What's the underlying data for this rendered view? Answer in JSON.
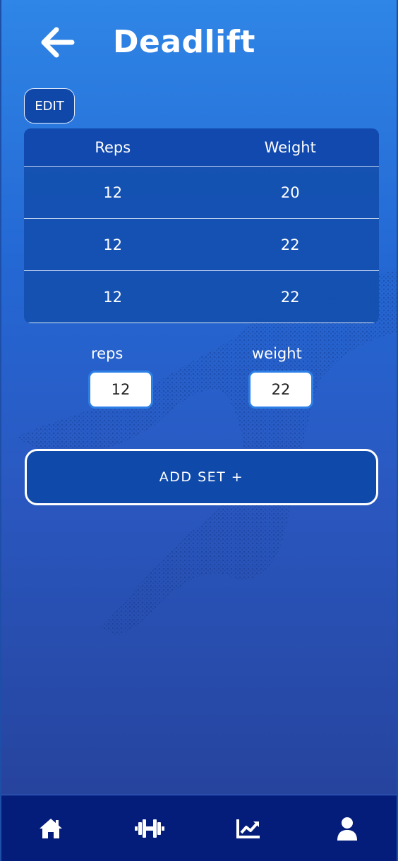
{
  "header": {
    "title": "Deadlift",
    "back_icon": "arrow-left-icon"
  },
  "edit_button": {
    "label": "EDIT"
  },
  "table": {
    "columns": [
      "Reps",
      "Weight"
    ],
    "rows": [
      {
        "reps": "12",
        "weight": "20"
      },
      {
        "reps": "12",
        "weight": "22"
      },
      {
        "reps": "12",
        "weight": "22"
      }
    ]
  },
  "inputs": {
    "reps": {
      "label": "reps",
      "value": "12"
    },
    "weight": {
      "label": "weight",
      "value": "22"
    }
  },
  "add_button": {
    "label": "ADD SET +"
  },
  "bottom_nav": [
    {
      "icon": "home-icon"
    },
    {
      "icon": "dumbbell-icon"
    },
    {
      "icon": "chart-line-icon"
    },
    {
      "icon": "user-icon"
    }
  ],
  "colors": {
    "accent": "#0f4aab",
    "nav_bg": "#041d7a",
    "input_border": "#2d7fe6"
  }
}
